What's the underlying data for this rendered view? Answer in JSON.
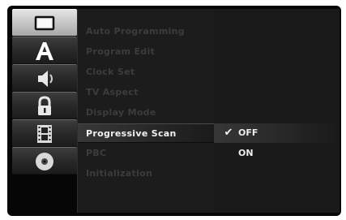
{
  "sidebar": {
    "items": [
      {
        "icon": "tv-screen-icon",
        "active": true
      },
      {
        "icon": "language-a-icon",
        "active": false
      },
      {
        "icon": "speaker-audio-icon",
        "active": false
      },
      {
        "icon": "padlock-lock-icon",
        "active": false
      },
      {
        "icon": "film-strip-icon",
        "active": false
      },
      {
        "icon": "disc-icon",
        "active": false
      }
    ]
  },
  "menu": {
    "items": [
      {
        "label": "Auto Programming",
        "selected": false
      },
      {
        "label": "Program Edit",
        "selected": false
      },
      {
        "label": "Clock Set",
        "selected": false
      },
      {
        "label": "TV Aspect",
        "selected": false
      },
      {
        "label": "Display Mode",
        "selected": false
      },
      {
        "label": "Progressive Scan",
        "selected": true
      },
      {
        "label": "PBC",
        "selected": false
      },
      {
        "label": "Initialization",
        "selected": false
      }
    ]
  },
  "submenu": {
    "options": [
      {
        "label": "OFF",
        "checked": true,
        "check_glyph": "✔"
      },
      {
        "label": "ON",
        "checked": false,
        "check_glyph": ""
      }
    ]
  }
}
